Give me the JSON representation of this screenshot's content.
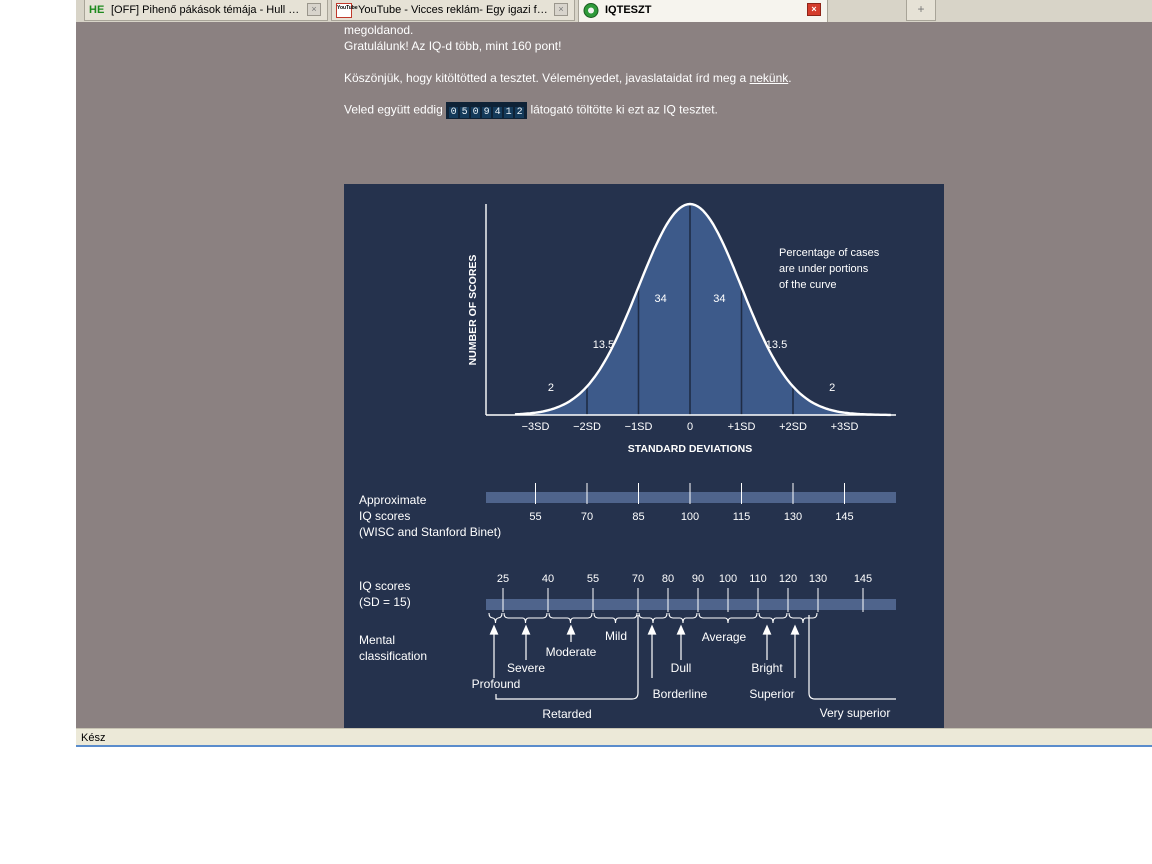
{
  "tabs": [
    {
      "favicon": "HE",
      "title": "[OFF] Pihenő pákások témája - Hull a h...",
      "active": false
    },
    {
      "favicon": "YouTube",
      "title": "YouTube - Vicces reklám- Egy igazi férf...",
      "active": false
    },
    {
      "favicon": "iq-icon",
      "title": "IQTESZT",
      "active": true
    }
  ],
  "newtab_label": "+",
  "page": {
    "line1": "megoldanod.",
    "line2": "Gratulálunk! Az IQ-d több, mint 160 pont!",
    "thanks_pre": "Köszönjük, hogy kitöltötted a tesztet. Véleményedet, javaslataidat írd meg a ",
    "thanks_link": "nekünk",
    "thanks_post": ".",
    "counter_pre": "Veled együtt eddig",
    "counter_digits": [
      "0",
      "5",
      "0",
      "9",
      "4",
      "1",
      "2"
    ],
    "counter_post": "látogató töltötte ki ezt az IQ tesztet."
  },
  "chart_data": {
    "type": "area",
    "ylabel": "NUMBER OF SCORES",
    "xlabel": "STANDARD DEVIATIONS",
    "annotation": "Percentage of cases are under portions of the curve",
    "annotation_lines": [
      "Percentage of cases",
      "are under portions",
      "of the curve"
    ],
    "x_ticks": [
      "−3SD",
      "−2SD",
      "−1SD",
      "0",
      "+1SD",
      "+2SD",
      "+3SD"
    ],
    "x_tick_values": [
      -3,
      -2,
      -1,
      0,
      1,
      2,
      3
    ],
    "xlim": [
      -3.4,
      4.1
    ],
    "segments": [
      {
        "from": -3,
        "to": -2,
        "percent": "2"
      },
      {
        "from": -2,
        "to": -1,
        "percent": "13.5"
      },
      {
        "from": -1,
        "to": 0,
        "percent": "34"
      },
      {
        "from": 0,
        "to": 1,
        "percent": "34"
      },
      {
        "from": 1,
        "to": 2,
        "percent": "13.5"
      },
      {
        "from": 2,
        "to": 3,
        "percent": "2"
      }
    ],
    "approx_label": [
      "Approximate",
      "IQ scores",
      "(WISC and Stanford  Binet)"
    ],
    "approx_scores": [
      55,
      70,
      85,
      100,
      115,
      130,
      145
    ],
    "iq_label": [
      "IQ scores",
      "(SD = 15)"
    ],
    "iq_scores": [
      25,
      40,
      55,
      70,
      80,
      90,
      100,
      110,
      120,
      130,
      145
    ],
    "mental_label": [
      "Mental",
      "classification"
    ],
    "classifications": {
      "profound": "Profound",
      "severe": "Severe",
      "moderate": "Moderate",
      "mild": "Mild",
      "dull": "Dull",
      "average": "Average",
      "bright": "Bright",
      "borderline": "Borderline",
      "superior": "Superior",
      "retarded": "Retarded",
      "very_superior": "Very superior"
    },
    "colors": {
      "background": "#25324d",
      "fill": "#3d5a8a",
      "curve": "#ffffff",
      "bar": "#4f648c"
    }
  },
  "status": "Kész"
}
